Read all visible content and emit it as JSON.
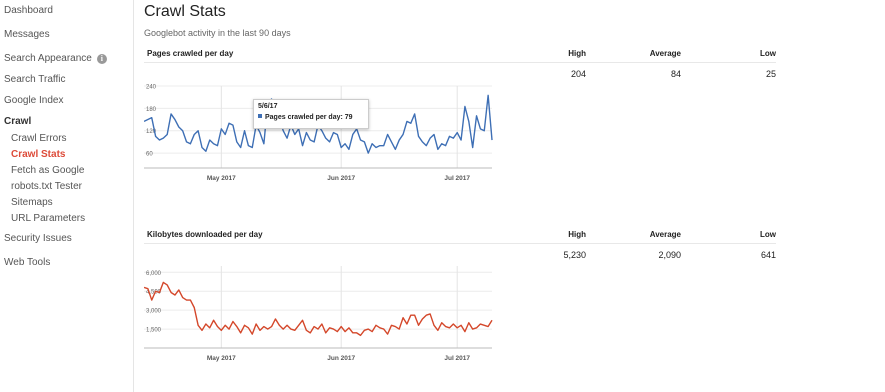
{
  "sidebar": {
    "items": [
      {
        "label": "Dashboard"
      },
      {
        "label": "Messages"
      },
      {
        "label": "Search Appearance",
        "icon": "info-icon"
      },
      {
        "label": "Search Traffic"
      },
      {
        "label": "Google Index"
      },
      {
        "label": "Crawl"
      },
      {
        "label": "Crawl Errors"
      },
      {
        "label": "Crawl Stats"
      },
      {
        "label": "Fetch as Google"
      },
      {
        "label": "robots.txt Tester"
      },
      {
        "label": "Sitemaps"
      },
      {
        "label": "URL Parameters"
      },
      {
        "label": "Security Issues"
      },
      {
        "label": "Web Tools"
      }
    ],
    "info_icon_glyph": "i",
    "active_color": "#dd4b39"
  },
  "header": {
    "title": "Crawl Stats",
    "subtitle": "Googlebot activity in the last 90 days"
  },
  "stats_headers": {
    "high": "High",
    "average": "Average",
    "low": "Low"
  },
  "pages_section": {
    "title": "Pages crawled per day",
    "high": "204",
    "average": "84",
    "low": "25"
  },
  "kb_section": {
    "title": "Kilobytes downloaded per day",
    "high": "5,230",
    "average": "2,090",
    "low": "641"
  },
  "tooltip": {
    "date": "5/6/17",
    "label": "Pages crawled per day:",
    "value": "79"
  },
  "chart_data": [
    {
      "type": "line",
      "title": "Pages crawled per day",
      "color": "#3e6fb5",
      "ylim": [
        20,
        240
      ],
      "yticks": [
        "240",
        "180",
        "120",
        "60"
      ],
      "ytick_values": [
        240,
        180,
        120,
        60
      ],
      "xtick_labels": [
        "May 2017",
        "Jun 2017",
        "Jul 2017"
      ],
      "xtick_positions": [
        20,
        51,
        81
      ],
      "x_count": 91,
      "values": [
        145,
        150,
        155,
        105,
        95,
        100,
        110,
        165,
        150,
        130,
        120,
        90,
        85,
        110,
        120,
        75,
        65,
        95,
        85,
        80,
        125,
        110,
        140,
        135,
        90,
        75,
        120,
        80,
        75,
        135,
        115,
        85,
        195,
        205,
        175,
        155,
        120,
        100,
        135,
        110,
        125,
        80,
        115,
        95,
        90,
        135,
        120,
        100,
        90,
        115,
        110,
        75,
        85,
        70,
        110,
        125,
        95,
        90,
        60,
        85,
        75,
        80,
        80,
        110,
        90,
        70,
        95,
        110,
        145,
        140,
        165,
        105,
        90,
        80,
        100,
        110,
        70,
        85,
        80,
        105,
        100,
        115,
        95,
        185,
        145,
        75,
        160,
        125,
        120,
        215,
        95
      ]
    },
    {
      "type": "line",
      "title": "Kilobytes downloaded per day",
      "color": "#d4472a",
      "ylim": [
        0,
        6500
      ],
      "yticks": [
        "6,000",
        "4,500",
        "3,000",
        "1,500"
      ],
      "ytick_values": [
        6000,
        4500,
        3000,
        1500
      ],
      "xtick_labels": [
        "May 2017",
        "Jun 2017",
        "Jul 2017"
      ],
      "xtick_positions": [
        20,
        51,
        81
      ],
      "x_count": 91,
      "values": [
        4800,
        4700,
        3800,
        4500,
        4400,
        5200,
        5000,
        4400,
        4200,
        4600,
        4000,
        3800,
        3800,
        3200,
        1800,
        1400,
        1900,
        1600,
        2200,
        1700,
        1400,
        1800,
        1500,
        2100,
        1700,
        1200,
        1800,
        1600,
        1100,
        1900,
        1400,
        1700,
        1500,
        1700,
        2300,
        1800,
        1500,
        1800,
        1500,
        1400,
        1800,
        2200,
        1400,
        1200,
        1700,
        1500,
        1900,
        1200,
        1600,
        1500,
        1300,
        1700,
        1300,
        1600,
        1200,
        1200,
        1000,
        1400,
        1500,
        1300,
        1800,
        1600,
        1500,
        1100,
        1800,
        1700,
        1500,
        2400,
        1900,
        2600,
        2600,
        1800,
        2300,
        2600,
        2700,
        1800,
        1400,
        2000,
        1700,
        1600,
        1900,
        1600,
        1800,
        1300,
        2000,
        1500,
        1600,
        1900,
        1800,
        1700,
        2200
      ]
    }
  ]
}
